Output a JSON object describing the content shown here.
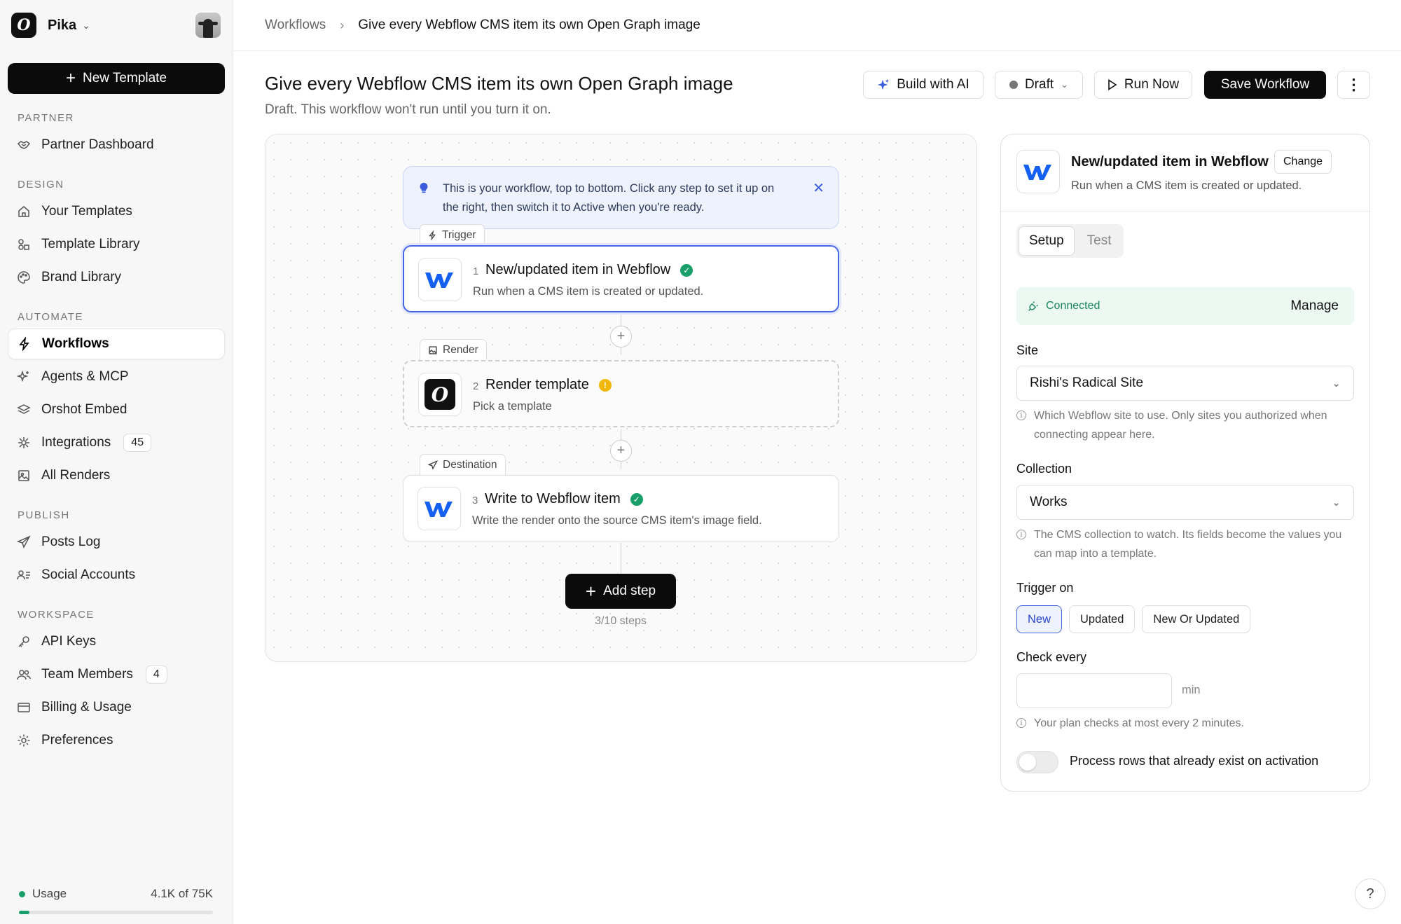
{
  "sidebar": {
    "workspace_name": "Pika",
    "new_template_label": "New Template",
    "sections": {
      "partner": "PARTNER",
      "design": "DESIGN",
      "automate": "AUTOMATE",
      "publish": "PUBLISH",
      "workspace": "WORKSPACE"
    },
    "items": {
      "partner_dashboard": "Partner Dashboard",
      "your_templates": "Your Templates",
      "template_library": "Template Library",
      "brand_library": "Brand Library",
      "workflows": "Workflows",
      "agents_mcp": "Agents & MCP",
      "orshot_embed": "Orshot Embed",
      "integrations": "Integrations",
      "integrations_count": "45",
      "all_renders": "All Renders",
      "posts_log": "Posts Log",
      "social_accounts": "Social Accounts",
      "api_keys": "API Keys",
      "team_members": "Team Members",
      "team_members_count": "4",
      "billing_usage": "Billing & Usage",
      "preferences": "Preferences"
    },
    "usage": {
      "label": "Usage",
      "value": "4.1K of 75K",
      "fraction": 0.055
    }
  },
  "breadcrumb": {
    "parent": "Workflows",
    "current": "Give every Webflow CMS item its own Open Graph image"
  },
  "header": {
    "title": "Give every Webflow CMS item its own Open Graph image",
    "subtitle": "Draft. This workflow won't run until you turn it on.",
    "build_ai_label": "Build with AI",
    "status_label": "Draft",
    "run_now_label": "Run Now",
    "save_label": "Save Workflow"
  },
  "canvas": {
    "tip": "This is your workflow, top to bottom. Click any step to set it up on the right, then switch it to Active when you're ready.",
    "steps": [
      {
        "tag": "Trigger",
        "num": "1",
        "title": "New/updated item in Webflow",
        "desc": "Run when a CMS item is created or updated.",
        "status": "ok"
      },
      {
        "tag": "Render",
        "num": "2",
        "title": "Render template",
        "desc": "Pick a template",
        "status": "warning"
      },
      {
        "tag": "Destination",
        "num": "3",
        "title": "Write to Webflow item",
        "desc": "Write the render onto the source CMS item's image field.",
        "status": "ok"
      }
    ],
    "add_step_label": "Add step",
    "steps_count": "3/10 steps"
  },
  "panel": {
    "title": "New/updated item in Webflow",
    "subtitle": "Run when a CMS item is created or updated.",
    "change_label": "Change",
    "tabs": [
      "Setup",
      "Test"
    ],
    "connected_label": "Connected",
    "manage_label": "Manage",
    "site_label": "Site",
    "site_value": "Rishi's Radical Site",
    "site_hint": "Which Webflow site to use. Only sites you authorized when connecting appear here.",
    "collection_label": "Collection",
    "collection_value": "Works",
    "collection_hint": "The CMS collection to watch. Its fields become the values you can map into a template.",
    "trigger_on_label": "Trigger on",
    "trigger_options": [
      "New",
      "Updated",
      "New Or Updated"
    ],
    "check_every_label": "Check every",
    "check_every_value": "",
    "check_every_unit": "min",
    "check_every_hint": "Your plan checks at most every 2 minutes.",
    "toggle_label": "Process rows that already exist on activation",
    "toggle_on": false
  },
  "colors": {
    "accent_blue": "#4666e8",
    "success_green": "#19a06a",
    "warning_yellow": "#f2b705",
    "dark_button": "#0b0b0b"
  }
}
